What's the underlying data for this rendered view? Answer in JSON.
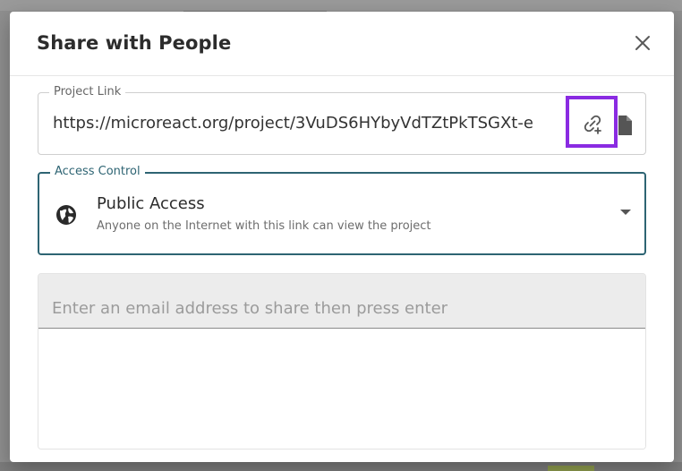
{
  "dialog": {
    "title": "Share with People"
  },
  "project_link": {
    "label": "Project Link",
    "value": "https://microreact.org/project/3VuDS6HYbyVdTZtPkTSGXt-e"
  },
  "icons": {
    "close": "close-icon",
    "add_link": "add-link-icon",
    "copy": "copy-icon",
    "globe": "globe-icon",
    "dropdown": "chevron-down-icon"
  },
  "access_control": {
    "label": "Access Control",
    "selected_title": "Public Access",
    "selected_description": "Anyone on the Internet with this link can view the project"
  },
  "email": {
    "placeholder": "Enter an email address to share then press enter",
    "value": ""
  },
  "colors": {
    "accent": "#2e6473",
    "highlight": "#8a2be2"
  }
}
